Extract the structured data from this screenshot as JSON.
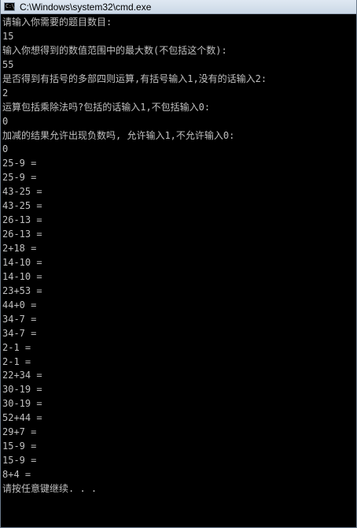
{
  "window": {
    "title": "C:\\Windows\\system32\\cmd.exe",
    "icon": "cmd-icon",
    "background_color": "#000000",
    "text_color": "#c0c0c0"
  },
  "console": {
    "lines": [
      "请输入你需要的题目数目:",
      "15",
      "输入你想得到的数值范围中的最大数(不包括这个数):",
      "55",
      "是否得到有括号的多部四则运算,有括号输入1,没有的话输入2:",
      "2",
      "运算包括乘除法吗?包括的话输入1,不包括输入0:",
      "0",
      "加减的结果允许出现负数吗, 允许输入1,不允许输入0:",
      "0",
      "25-9 =",
      "25-9 =",
      "43-25 =",
      "43-25 =",
      "26-13 =",
      "26-13 =",
      "2+18 =",
      "14-10 =",
      "14-10 =",
      "23+53 =",
      "44+0 =",
      "34-7 =",
      "34-7 =",
      "2-1 =",
      "2-1 =",
      "22+34 =",
      "30-19 =",
      "30-19 =",
      "52+44 =",
      "29+7 =",
      "15-9 =",
      "15-9 =",
      "8+4 =",
      "请按任意键继续. . ."
    ]
  }
}
